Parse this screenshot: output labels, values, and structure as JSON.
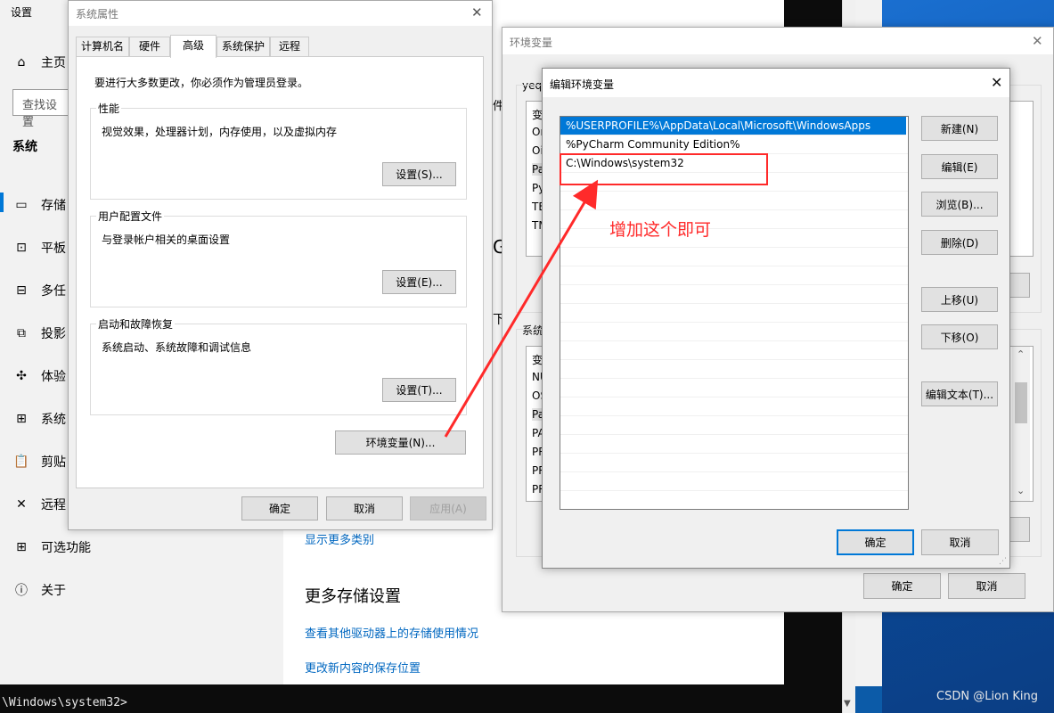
{
  "settings": {
    "title": "设置",
    "home": "主页",
    "search_placeholder": "查找设置",
    "section": "系统",
    "nav": [
      {
        "icon": "storage-icon",
        "glyph": "▭",
        "label": "存储"
      },
      {
        "icon": "tablet-icon",
        "glyph": "⊡",
        "label": "平板"
      },
      {
        "icon": "multitask-icon",
        "glyph": "⊟",
        "label": "多任"
      },
      {
        "icon": "project-icon",
        "glyph": "⧉",
        "label": "投影"
      },
      {
        "icon": "experience-icon",
        "glyph": "✣",
        "label": "体验"
      },
      {
        "icon": "system-components-icon",
        "glyph": "⊞",
        "label": "系统"
      },
      {
        "icon": "clipboard-icon",
        "glyph": "📋",
        "label": "剪贴"
      },
      {
        "icon": "remote-icon",
        "glyph": "✕",
        "label": "远程"
      },
      {
        "icon": "optional-features-icon",
        "glyph": "⊞",
        "label": "可选功能"
      },
      {
        "icon": "about-icon",
        "glyph": "ⓘ",
        "label": "关于"
      }
    ],
    "show_more": "显示更多类别",
    "more_storage_title": "更多存储设置",
    "link1": "查看其他驱动器上的存储使用情况",
    "link2": "更改新内容的保存位置",
    "peek_texts": [
      "件",
      "G",
      "下"
    ]
  },
  "console": {
    "text": "\\Windows\\system32>"
  },
  "watermark": "CSDN @Lion King",
  "sysprops": {
    "title": "系统属性",
    "tabs": [
      "计算机名",
      "硬件",
      "高级",
      "系统保护",
      "远程"
    ],
    "admin_note": "要进行大多数更改，你必须作为管理员登录。",
    "perf": {
      "title": "性能",
      "desc": "视觉效果，处理器计划，内存使用，以及虚拟内存",
      "button": "设置(S)..."
    },
    "profile": {
      "title": "用户配置文件",
      "desc": "与登录帐户相关的桌面设置",
      "button": "设置(E)..."
    },
    "startup": {
      "title": "启动和故障恢复",
      "desc": "系统启动、系统故障和调试信息",
      "button": "设置(T)..."
    },
    "env_button": "环境变量(N)...",
    "ok": "确定",
    "cancel": "取消",
    "apply": "应用(A)"
  },
  "envvars": {
    "title": "环境变量",
    "user_label": "yeqi",
    "user_rows": [
      "变",
      "On",
      "Oi",
      "Pa",
      "Py",
      "TE",
      "TM"
    ],
    "sys_label": "系统",
    "sys_rows": [
      "变",
      "NU",
      "OS",
      "Pa",
      "PA",
      "PR",
      "PR",
      "PR"
    ],
    "ok": "确定",
    "cancel": "取消"
  },
  "editenv": {
    "title": "编辑环境变量",
    "entries": [
      "%USERPROFILE%\\AppData\\Local\\Microsoft\\WindowsApps",
      "%PyCharm Community Edition%",
      "C:\\Windows\\system32"
    ],
    "buttons": {
      "new": "新建(N)",
      "edit": "编辑(E)",
      "browse": "浏览(B)...",
      "delete": "删除(D)",
      "up": "上移(U)",
      "down": "下移(O)",
      "edit_text": "编辑文本(T)..."
    },
    "ok": "确定",
    "cancel": "取消"
  },
  "annotation": {
    "text": "增加这个即可",
    "color": "#ff2a2a"
  }
}
